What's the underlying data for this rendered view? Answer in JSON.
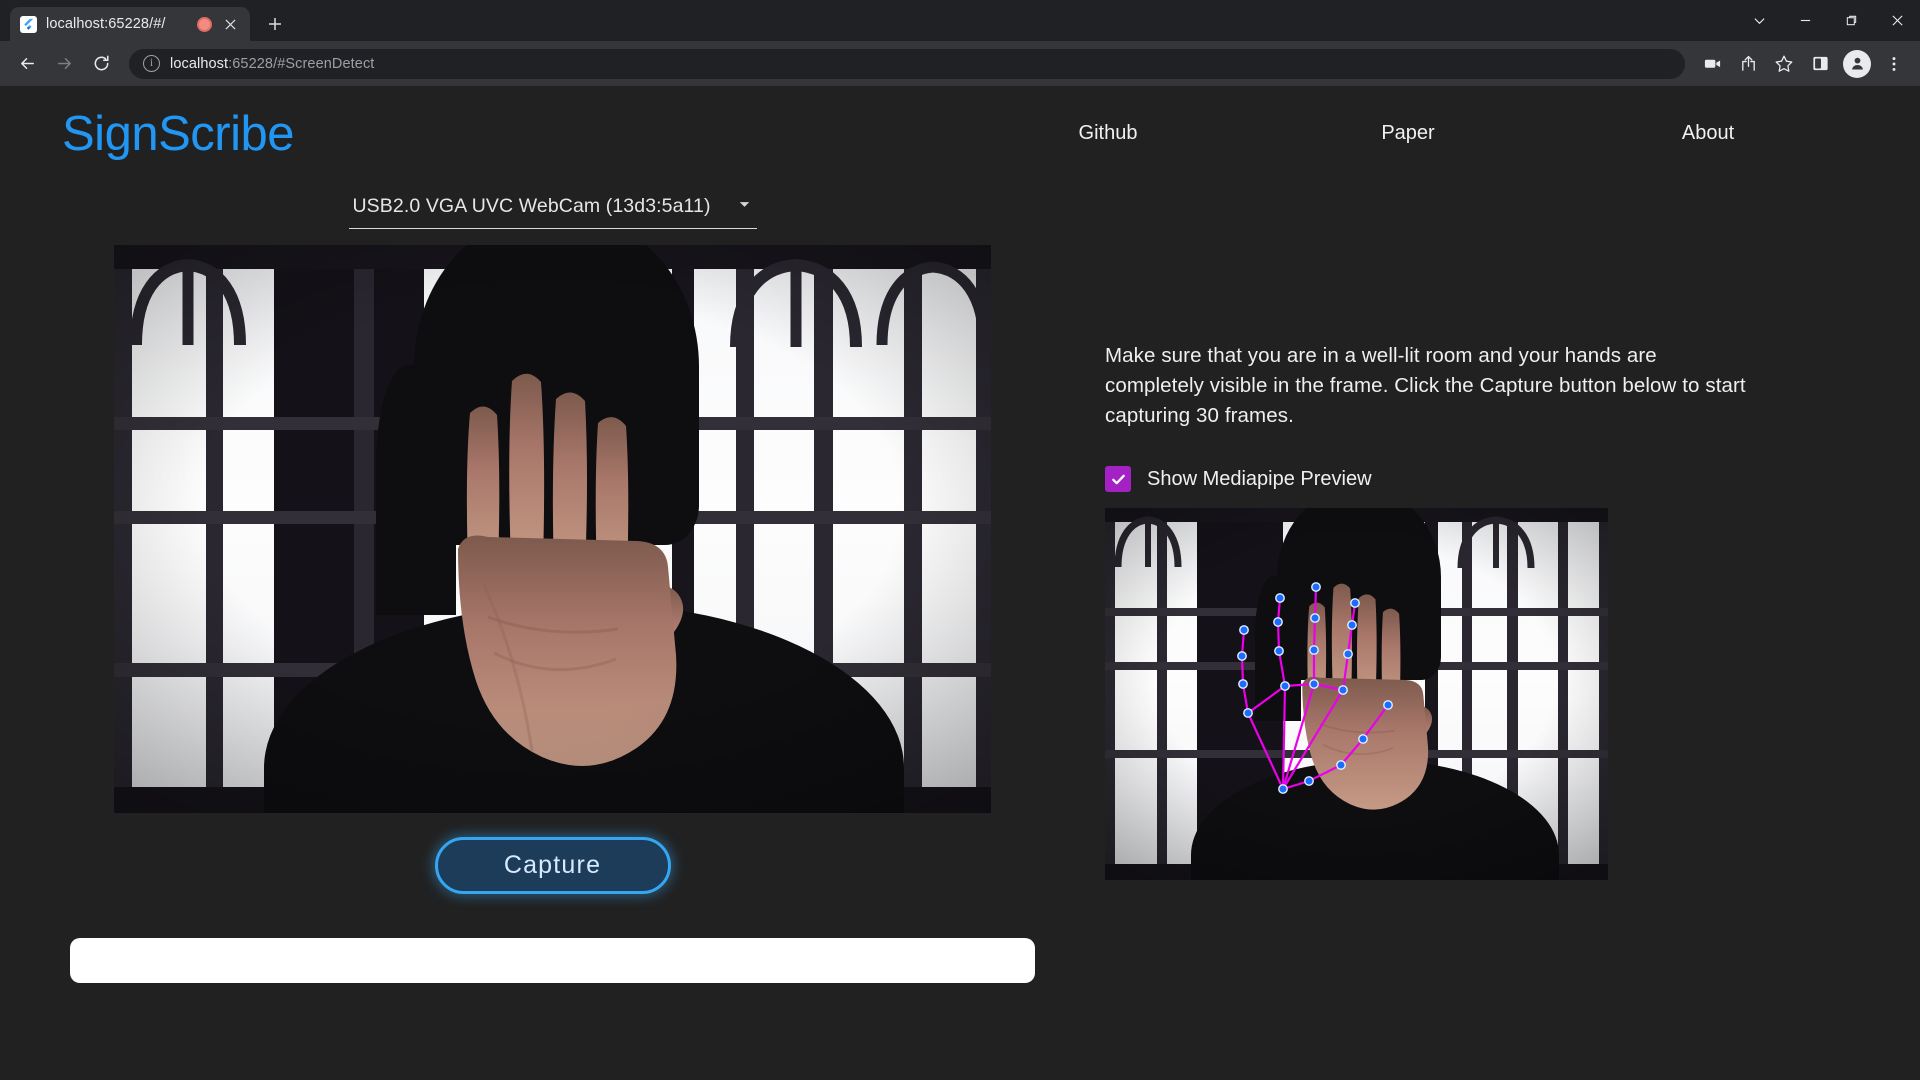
{
  "browser": {
    "tab": {
      "title": "localhost:65228/#/",
      "favicon_icon": "flutter-logo-icon",
      "recording_indicator_icon": "recording-dot-icon",
      "close_icon": "close-icon"
    },
    "new_tab_icon": "plus-icon",
    "window_controls": {
      "expand_icon": "chevron-down-icon",
      "minimize_icon": "minimize-icon",
      "restore_icon": "restore-icon",
      "close_icon": "close-icon"
    },
    "toolbar": {
      "back_icon": "back-arrow-icon",
      "forward_icon": "forward-arrow-icon",
      "reload_icon": "reload-icon",
      "site_info_icon": "info-circle-icon",
      "url_host": "localhost",
      "url_rest": ":65228/#ScreenDetect",
      "cast_icon": "video-camera-icon",
      "share_icon": "share-icon",
      "bookmark_icon": "star-icon",
      "side_panel_icon": "side-panel-icon",
      "profile_icon": "profile-avatar-icon",
      "menu_icon": "three-dots-menu-icon"
    }
  },
  "site": {
    "brand": "SignScribe",
    "brand_color": "#2196f3",
    "nav": [
      {
        "label": "Github"
      },
      {
        "label": "Paper"
      },
      {
        "label": "About"
      }
    ]
  },
  "main": {
    "camera_select": {
      "value": "USB2.0 VGA UVC WebCam (13d3:5a11)",
      "caret_icon": "chevron-down-icon"
    },
    "webcam_feed_alt": "Live webcam feed: person with raised open palm in front of a bright window",
    "capture_button": "Capture",
    "result_value": "",
    "result_placeholder": ""
  },
  "sidebar": {
    "instructions": "Make sure that you are in a well-lit room and your hands are completely visible in the frame. Click the Capture button below to start capturing 30 frames.",
    "mediapipe_toggle": {
      "label": "Show Mediapipe Preview",
      "checked": true,
      "accent_color": "#a421c4",
      "check_icon": "check-icon"
    },
    "mediapipe_preview_alt": "Mediapipe preview showing hand landmark skeleton overlay on the webcam frame"
  }
}
